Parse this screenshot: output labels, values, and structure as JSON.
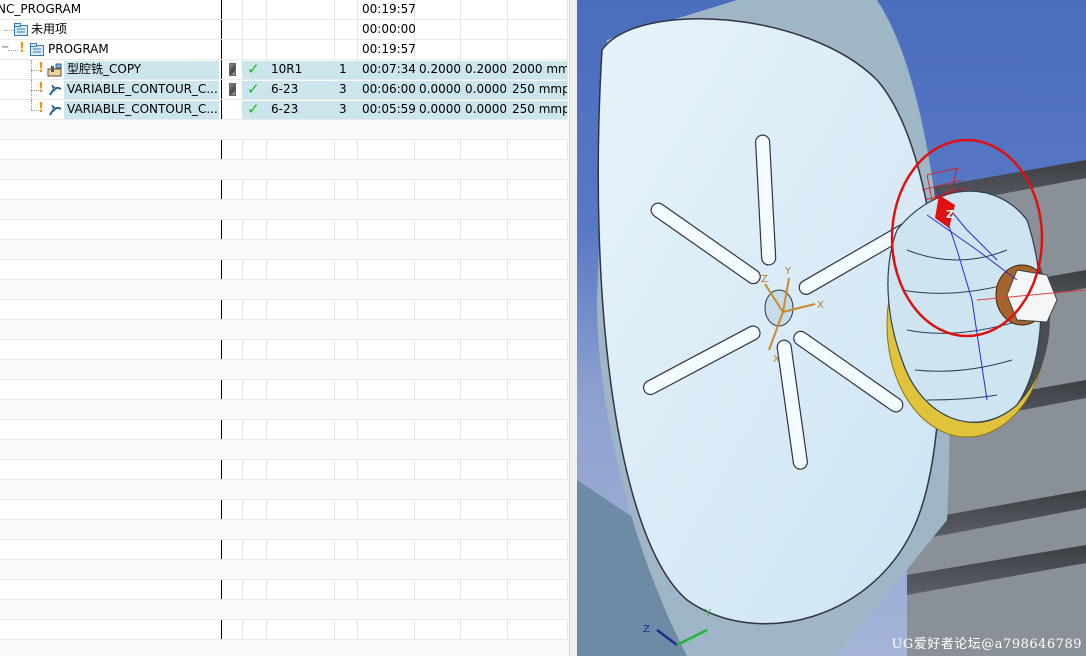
{
  "navigator": {
    "rows": [
      {
        "name": "NC_PROGRAM",
        "time": "00:19:57"
      },
      {
        "name": "未用项",
        "time": "00:00:00"
      },
      {
        "name": "PROGRAM",
        "time": "00:19:57"
      },
      {
        "name": "型腔铣_COPY",
        "tool": "10R1",
        "tool_num": "1",
        "time": "00:07:34",
        "stock_side": "0.2000",
        "stock_floor": "0.2000",
        "feed": "2000 mm"
      },
      {
        "name": "VARIABLE_CONTOUR_C...",
        "tool": "6-23",
        "tool_num": "3",
        "time": "00:06:00",
        "stock_side": "0.0000",
        "stock_floor": "0.0000",
        "feed": "250 mmp"
      },
      {
        "name": "VARIABLE_CONTOUR_C...",
        "tool": "6-23",
        "tool_num": "3",
        "time": "00:05:59",
        "stock_side": "0.0000",
        "stock_floor": "0.0000",
        "feed": "250 mmp"
      }
    ]
  },
  "viewport": {
    "triad_labels": {
      "x": "X",
      "y": "Y",
      "z": "Z"
    },
    "tool_axis_label": "Z",
    "watermark": "UG爱好者论坛@a798646789"
  },
  "colors": {
    "selection": "#cce4ec",
    "warning": "#e39a12",
    "complete": "#1fb71f",
    "background_top": "#4a6dbd",
    "highlight_circle": "#e01010"
  },
  "icons": {
    "group_row": "folder-icon",
    "cavity_mill": "cavity-mill-icon",
    "contour": "variable-contour-icon",
    "status": "check-icon",
    "regenerate": "exclamation-icon"
  }
}
